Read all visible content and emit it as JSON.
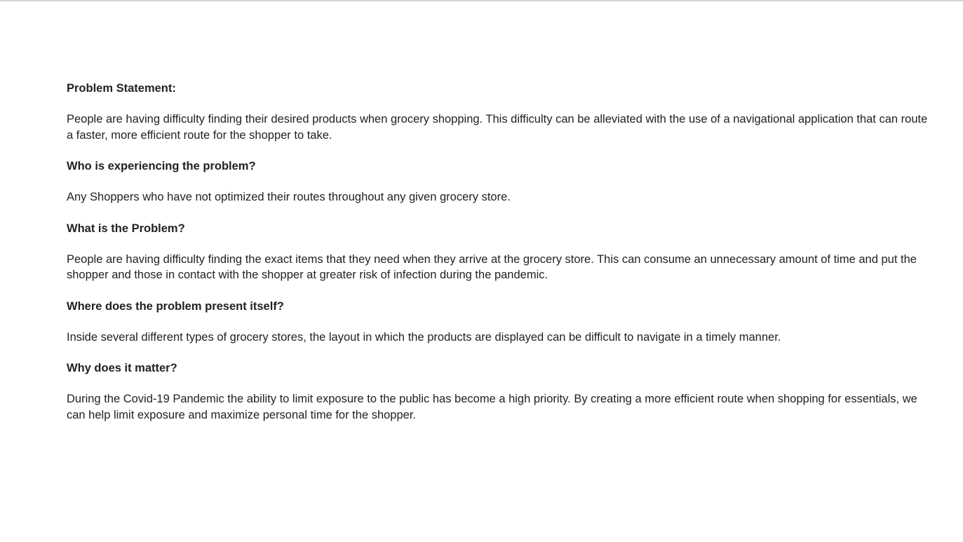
{
  "sections": [
    {
      "heading": "Problem Statement:",
      "body": "People are having difficulty finding their desired products when grocery shopping. This difficulty can be alleviated with the use of a navigational application that can route a faster, more efficient route for the shopper to take."
    },
    {
      "heading": "Who is experiencing the problem?",
      "body": "Any Shoppers who have not optimized their routes throughout any given grocery store."
    },
    {
      "heading": "What is the Problem?",
      "body": "People are having difficulty finding the exact items that they need when they arrive at the grocery store. This can consume an unnecessary amount of time and put the shopper and those in contact with the shopper at greater risk of infection during the pandemic."
    },
    {
      "heading": "Where does the problem present itself?",
      "body": "Inside several different types of grocery stores, the layout in which the products are displayed can be difficult to navigate in a timely manner."
    },
    {
      "heading": "Why does it matter?",
      "body": "During the Covid-19 Pandemic the ability to limit exposure to the public has become a high priority. By creating a more efficient route when shopping for essentials, we can help limit exposure and maximize personal time for the shopper."
    }
  ]
}
